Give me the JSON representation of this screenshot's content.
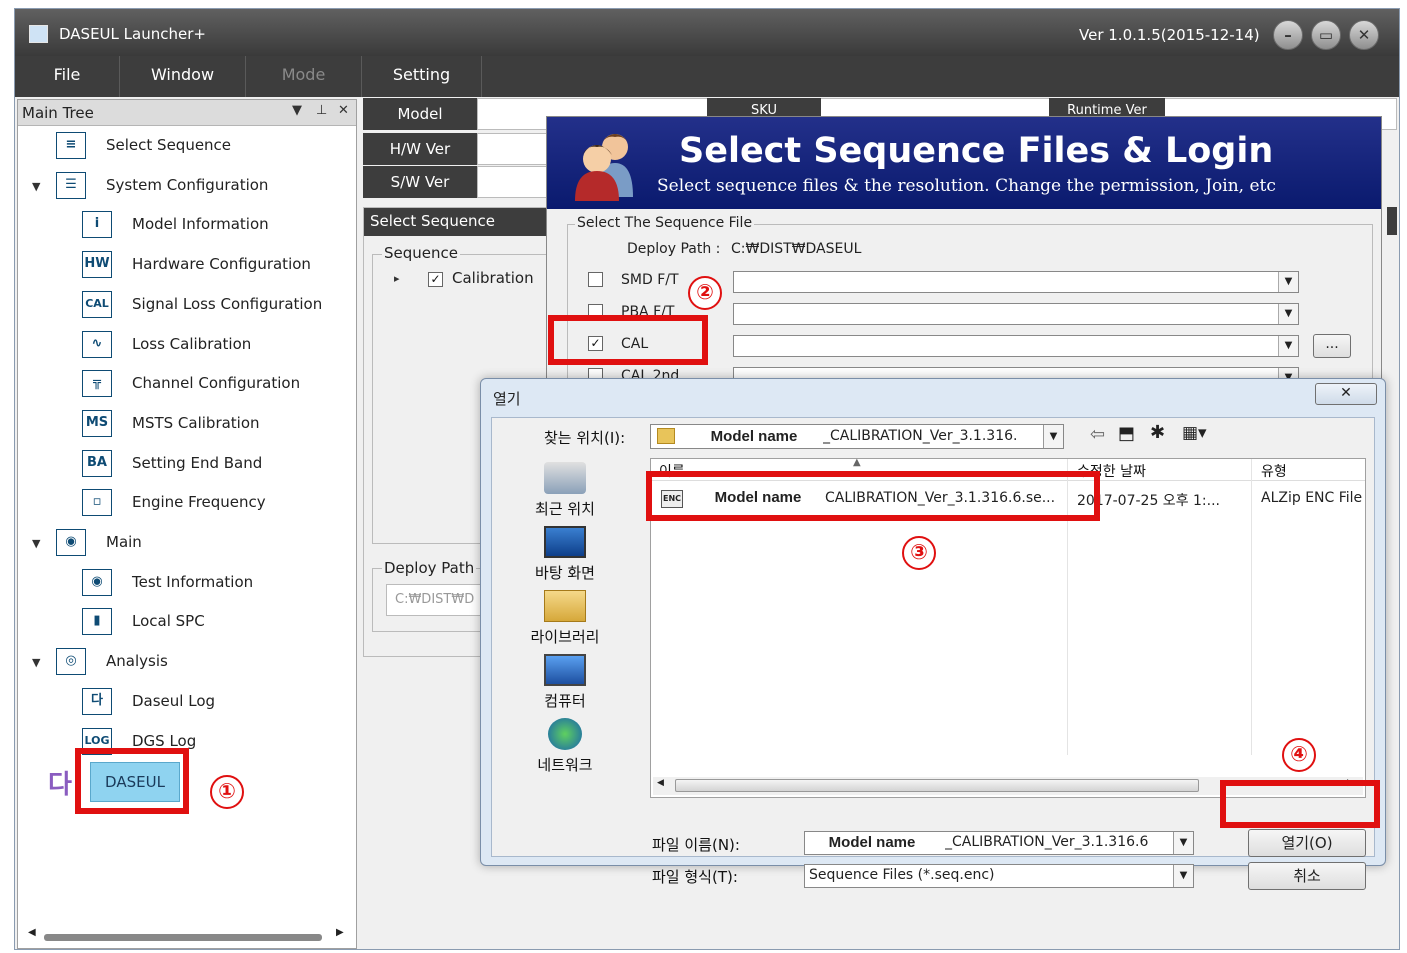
{
  "window": {
    "title": "DASEUL Launcher+",
    "version": "Ver 1.0.1.5(2015-12-14)"
  },
  "menu": [
    "File",
    "Window",
    "Mode",
    "Setting"
  ],
  "tree": {
    "header": "Main Tree",
    "items": [
      {
        "label": "Select Sequence",
        "icon": "select-sequence-icon",
        "glyph": "≡"
      },
      {
        "label": "System Configuration",
        "icon": "system-configuration-icon",
        "glyph": "☰"
      },
      {
        "label": "Model Information",
        "icon": "info-icon",
        "glyph": "i"
      },
      {
        "label": "Hardware Configuration",
        "icon": "hw-icon",
        "glyph": "HW"
      },
      {
        "label": "Signal Loss Configuration",
        "icon": "cal-icon",
        "glyph": "CAL"
      },
      {
        "label": "Loss Calibration",
        "icon": "waveform-icon",
        "glyph": "∿"
      },
      {
        "label": "Channel Configuration",
        "icon": "channel-icon",
        "glyph": "╦"
      },
      {
        "label": "MSTS Calibration",
        "icon": "msts-icon",
        "glyph": "MS"
      },
      {
        "label": "Setting End Band",
        "icon": "band-icon",
        "glyph": "BA"
      },
      {
        "label": "Engine Frequency",
        "icon": "engine-icon",
        "glyph": "▫"
      },
      {
        "label": "Main",
        "icon": "main-icon",
        "glyph": "◉"
      },
      {
        "label": "Test Information",
        "icon": "test-info-icon",
        "glyph": "◉"
      },
      {
        "label": "Local SPC",
        "icon": "spc-chart-icon",
        "glyph": "▮"
      },
      {
        "label": "Analysis",
        "icon": "analysis-icon",
        "glyph": "◎"
      },
      {
        "label": "Daseul Log",
        "icon": "log-icon",
        "glyph": "다"
      },
      {
        "label": "DGS Log",
        "icon": "dgs-log-icon",
        "glyph": "LOG"
      }
    ],
    "daseul_button": "DASEUL"
  },
  "info": {
    "model": "Model",
    "hw_ver": "H/W Ver",
    "sw_ver": "S/W Ver",
    "sku": "SKU",
    "runtime_ver": "Runtime Ver"
  },
  "select_sequence_panel": {
    "header": "Select Sequence",
    "group": "Sequence",
    "item": "Calibration",
    "deploy_group": "Deploy Path",
    "deploy_value": "C:₩DIST₩D"
  },
  "seq_dialog": {
    "heading": "Select Sequence Files & Login",
    "subheading": "Select sequence files & the resolution. Change the permission, Join, etc",
    "group": "Select The Sequence File",
    "deploy_label": "Deploy Path :",
    "deploy_value": "C:₩DIST₩DASEUL",
    "rows": [
      {
        "label": "SMD F/T",
        "checked": false
      },
      {
        "label": "PBA F/T",
        "checked": false
      },
      {
        "label": "CAL",
        "checked": true
      },
      {
        "label": "CAL 2nd",
        "checked": false
      }
    ],
    "browse": "..."
  },
  "open_dialog": {
    "title": "열기",
    "look_in_label": "찾는 위치(I):",
    "look_in_overlay": "Model name",
    "look_in_value": "_CALIBRATION_Ver_3.1.316.",
    "columns": [
      "이름",
      "수정한 날짜",
      "유형"
    ],
    "file": {
      "overlay": "Model name",
      "name": "CALIBRATION_Ver_3.1.316.6.se...",
      "date": "2017-07-25 오후 1:...",
      "type": "ALZip ENC File"
    },
    "places": [
      "최근 위치",
      "바탕 화면",
      "라이브러리",
      "컴퓨터",
      "네트워크"
    ],
    "filename_label": "파일 이름(N):",
    "filename_overlay": "Model name",
    "filename_value": "_CALIBRATION_Ver_3.1.316.6",
    "filetype_label": "파일 형식(T):",
    "filetype_value": "Sequence Files (*.seq.enc)",
    "open_button": "열기(O)",
    "cancel_button": "취소"
  },
  "callouts": [
    "①",
    "②",
    "③",
    "④"
  ],
  "colors": {
    "callout_red": "#e01010",
    "banner_blue": "#1a2a80",
    "dark_bar": "#3d3d3d",
    "daseul_button": "#8fd3f0"
  }
}
